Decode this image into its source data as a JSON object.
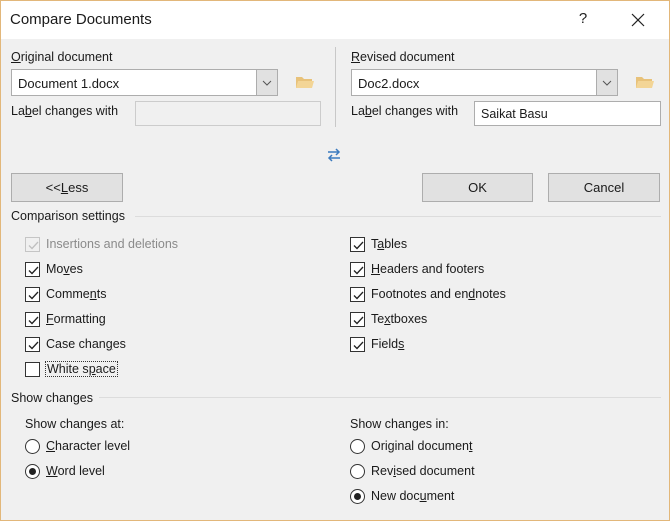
{
  "window": {
    "title": "Compare Documents",
    "help_label": "?",
    "border_color": "#e2b77a"
  },
  "original": {
    "heading_prefix": "",
    "heading_ul": "O",
    "heading_rest": "riginal document",
    "value": "Document 1.docx",
    "label_changes_pre": "La",
    "label_changes_ul": "b",
    "label_changes_post": "el changes with",
    "label_changes_value": "",
    "label_changes_enabled": false
  },
  "revised": {
    "heading_ul": "R",
    "heading_rest": "evised document",
    "value": "Doc2.docx",
    "label_changes_pre": "La",
    "label_changes_ul": "b",
    "label_changes_post": "el changes with",
    "label_changes_value": "Saikat Basu"
  },
  "swap_icon": "swap-arrows-icon",
  "buttons": {
    "less_pre": "<< ",
    "less_ul": "L",
    "less_post": "ess",
    "ok": "OK",
    "cancel": "Cancel"
  },
  "comparison_settings": {
    "title": "Comparison settings",
    "left": [
      {
        "pre": "Insertions and deletions",
        "ul": "",
        "post": "",
        "checked": true,
        "disabled": true
      },
      {
        "pre": "Mo",
        "ul": "v",
        "post": "es",
        "checked": true,
        "disabled": false
      },
      {
        "pre": "Comme",
        "ul": "n",
        "post": "ts",
        "checked": true,
        "disabled": false
      },
      {
        "pre": "",
        "ul": "F",
        "post": "ormatting",
        "checked": true,
        "disabled": false
      },
      {
        "pre": "Case chan",
        "ul": "g",
        "post": "es",
        "checked": true,
        "disabled": false
      },
      {
        "pre": "White s",
        "ul": "p",
        "post": "ace",
        "checked": false,
        "disabled": false,
        "focused": true
      }
    ],
    "right": [
      {
        "pre": "T",
        "ul": "a",
        "post": "bles",
        "checked": true
      },
      {
        "pre": "",
        "ul": "H",
        "post": "eaders and footers",
        "checked": true
      },
      {
        "pre": "Footnotes and en",
        "ul": "d",
        "post": "notes",
        "checked": true
      },
      {
        "pre": "Te",
        "ul": "x",
        "post": "tboxes",
        "checked": true
      },
      {
        "pre": "Field",
        "ul": "s",
        "post": "",
        "checked": true
      }
    ]
  },
  "show_changes": {
    "title": "Show changes",
    "at": {
      "label": "Show changes at:",
      "options": [
        {
          "pre": "",
          "ul": "C",
          "post": "haracter level",
          "selected": false
        },
        {
          "pre": "",
          "ul": "W",
          "post": "ord level",
          "selected": true
        }
      ]
    },
    "in": {
      "label": "Show changes in:",
      "options": [
        {
          "pre": "Original documen",
          "ul": "t",
          "post": "",
          "selected": false
        },
        {
          "pre": "Rev",
          "ul": "i",
          "post": "sed document",
          "selected": false
        },
        {
          "pre": "New doc",
          "ul": "u",
          "post": "ment",
          "selected": true
        }
      ]
    }
  }
}
